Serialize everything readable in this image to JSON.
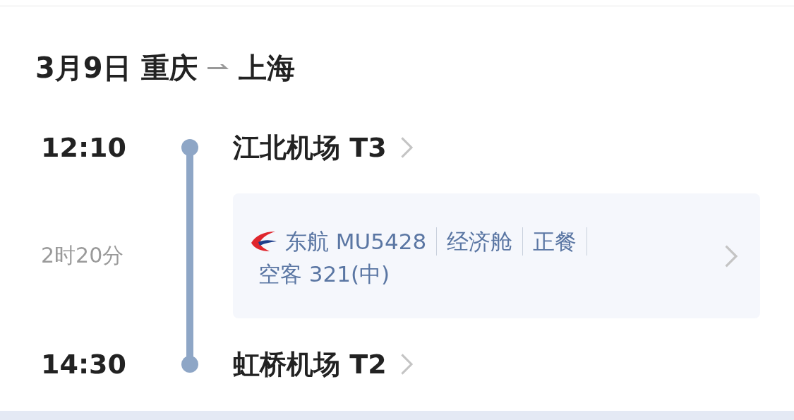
{
  "header": {
    "date": "3月9日",
    "from": "重庆",
    "to": "上海"
  },
  "departure": {
    "time": "12:10",
    "airport": "江北机场 T3"
  },
  "duration": "2时20分",
  "flight": {
    "tags": [
      "东航 MU5428",
      "经济舱",
      "正餐"
    ],
    "aircraft": "空客 321(中)"
  },
  "arrival": {
    "time": "14:30",
    "airport": "虹桥机场 T2"
  }
}
